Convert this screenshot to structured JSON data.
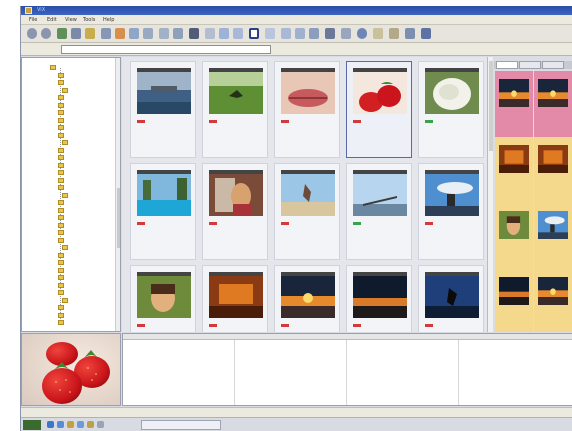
{
  "window": {
    "title": "ViX",
    "menu": [
      "File",
      "Edit",
      "View",
      "Tools",
      "Help"
    ]
  },
  "addressbar": {
    "label": "",
    "value": ""
  },
  "tree": {
    "items": [
      "",
      "",
      "",
      "",
      "",
      "",
      "",
      "",
      "",
      "",
      "",
      "",
      "",
      "",
      "",
      "",
      "",
      "",
      "",
      "",
      "",
      "",
      "",
      "",
      "",
      "",
      "",
      "",
      "",
      "",
      "",
      "",
      "",
      "",
      ""
    ]
  },
  "thumbnails": [
    {
      "row": 0,
      "col": 0,
      "line1": "",
      "line2": "",
      "mark": "red",
      "scene": "sea-pier",
      "selected": false
    },
    {
      "row": 0,
      "col": 1,
      "line1": "",
      "line2": "",
      "mark": "red",
      "scene": "grass-bird",
      "selected": false
    },
    {
      "row": 0,
      "col": 2,
      "line1": "",
      "line2": "",
      "mark": "red",
      "scene": "lips",
      "selected": false
    },
    {
      "row": 0,
      "col": 3,
      "line1": "",
      "line2": "",
      "mark": "red",
      "scene": "strawberry",
      "selected": true
    },
    {
      "row": 0,
      "col": 4,
      "line1": "",
      "line2": "",
      "mark": "green",
      "scene": "white-flower",
      "selected": false
    },
    {
      "row": 1,
      "col": 0,
      "line1": "",
      "line2": "",
      "mark": "red",
      "scene": "pool",
      "selected": false
    },
    {
      "row": 1,
      "col": 1,
      "line1": "",
      "line2": "",
      "mark": "red",
      "scene": "girl-window",
      "selected": false
    },
    {
      "row": 1,
      "col": 2,
      "line1": "",
      "line2": "",
      "mark": "red",
      "scene": "beach-jump",
      "selected": false
    },
    {
      "row": 1,
      "col": 3,
      "line1": "",
      "line2": "",
      "mark": "green",
      "scene": "sky-pier",
      "selected": false
    },
    {
      "row": 1,
      "col": 4,
      "line1": "",
      "line2": "",
      "mark": "red",
      "scene": "sky-people",
      "selected": false
    },
    {
      "row": 2,
      "col": 0,
      "line1": "",
      "line2": "",
      "mark": "red",
      "scene": "girl-smile",
      "selected": false
    },
    {
      "row": 2,
      "col": 1,
      "line1": "",
      "line2": "",
      "mark": "red",
      "scene": "orange-room",
      "selected": false
    },
    {
      "row": 2,
      "col": 2,
      "line1": "",
      "line2": "",
      "mark": "red",
      "scene": "sunset-sea",
      "selected": false
    },
    {
      "row": 2,
      "col": 3,
      "line1": "",
      "line2": "",
      "mark": "red",
      "scene": "sunset-dark",
      "selected": false
    },
    {
      "row": 2,
      "col": 4,
      "line1": "",
      "line2": "",
      "mark": "red",
      "scene": "jump-sky",
      "selected": false
    }
  ],
  "sidepanel": {
    "tabs": [
      "",
      "",
      ""
    ],
    "items": [
      {
        "bg": "#e38aa8",
        "scene": "sunset-sea",
        "text": ""
      },
      {
        "bg": "#e38aa8",
        "scene": "sunset-sea",
        "text": ""
      },
      {
        "bg": "#f4d98d",
        "scene": "orange-room",
        "text": ""
      },
      {
        "bg": "#f4d98d",
        "scene": "orange-room",
        "text": ""
      },
      {
        "bg": "#f4d98d",
        "scene": "girl-smile",
        "text": ""
      },
      {
        "bg": "#f4d98d",
        "scene": "sky-people",
        "text": ""
      },
      {
        "bg": "#f4d98d",
        "scene": "sunset-dark",
        "text": ""
      },
      {
        "bg": "#f4d98d",
        "scene": "sunset-sea",
        "text": ""
      }
    ]
  },
  "properties": {
    "columns": [
      {
        "rows": [
          {
            "k": "",
            "v": ""
          },
          {
            "k": "",
            "v": ""
          },
          {
            "k": "",
            "v": ""
          },
          {
            "k": "",
            "v": ""
          },
          {
            "k": "",
            "v": ""
          },
          {
            "k": "",
            "v": ""
          },
          {
            "k": "",
            "v": ""
          },
          {
            "k": "",
            "v": ""
          }
        ]
      },
      {
        "rows": [
          {
            "k": "",
            "v": ""
          },
          {
            "k": "",
            "v": ""
          },
          {
            "k": "",
            "v": ""
          },
          {
            "k": "",
            "v": ""
          },
          {
            "k": "",
            "v": ""
          },
          {
            "k": "",
            "v": ""
          },
          {
            "k": "",
            "v": ""
          },
          {
            "k": "",
            "v": ""
          }
        ]
      },
      {
        "rows": [
          {
            "k": "",
            "v": ""
          },
          {
            "k": "",
            "v": ""
          },
          {
            "k": "",
            "v": ""
          },
          {
            "k": "",
            "v": ""
          },
          {
            "k": "",
            "v": ""
          },
          {
            "k": "",
            "v": ""
          },
          {
            "k": "",
            "v": ""
          },
          {
            "k": "",
            "v": ""
          }
        ]
      },
      {
        "rows": [
          {
            "k": "",
            "v": ""
          },
          {
            "k": "",
            "v": ""
          },
          {
            "k": "",
            "v": ""
          },
          {
            "k": "",
            "v": ""
          },
          {
            "k": "",
            "v": ""
          },
          {
            "k": "",
            "v": ""
          },
          {
            "k": "",
            "v": ""
          },
          {
            "k": "",
            "v": ""
          }
        ]
      }
    ]
  },
  "statusbar": {
    "left": "",
    "right": ""
  },
  "taskbar": {
    "start": "",
    "app_button": "",
    "clock": ""
  },
  "colors": {
    "titlebar": "#2a4fa6",
    "selection": "#5a6aa8",
    "mark_red": "#d23b3b",
    "mark_green": "#3aa34a"
  }
}
